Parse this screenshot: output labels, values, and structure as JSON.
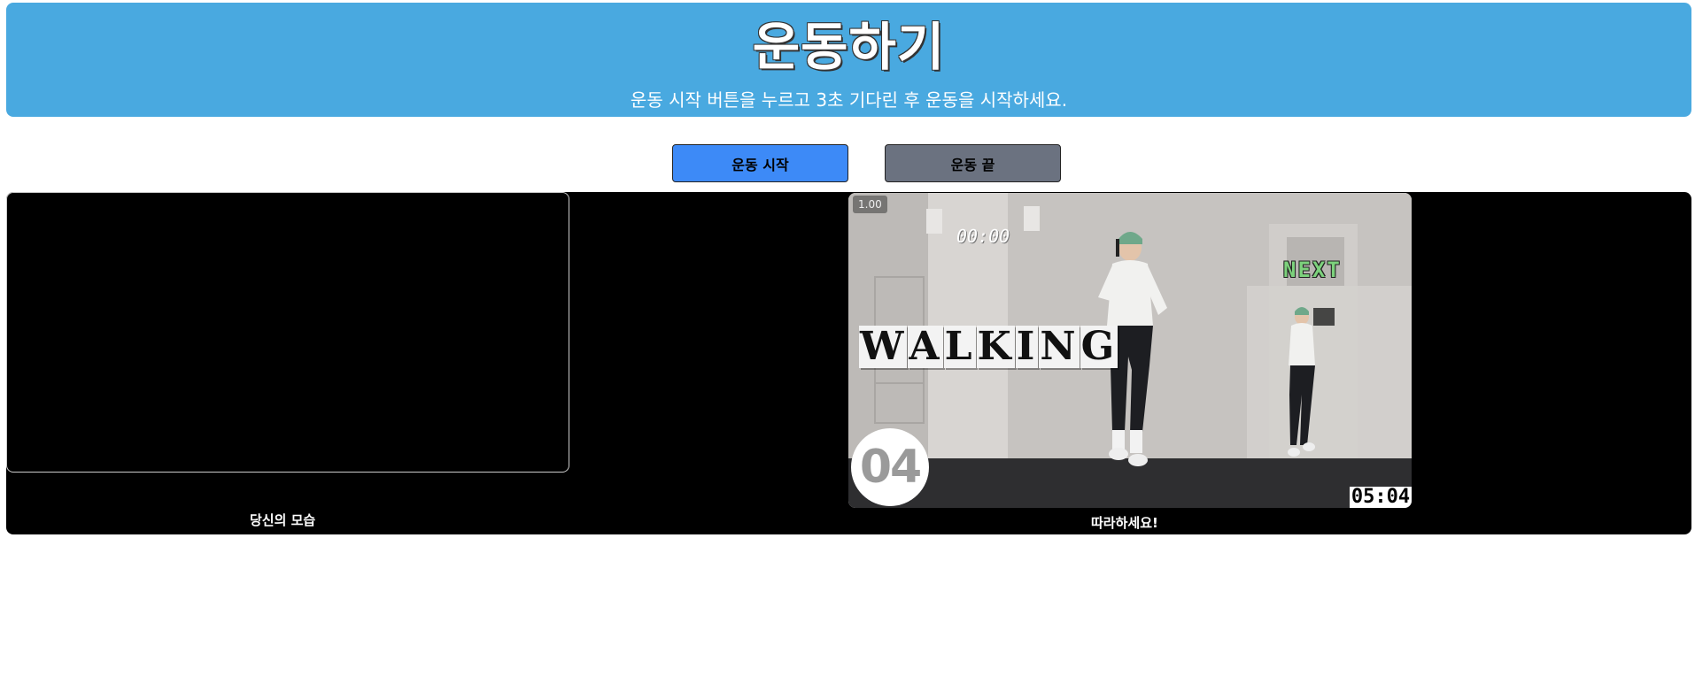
{
  "header": {
    "title": "운동하기",
    "subtitle": "운동 시작 버튼을 누르고 3초 기다린 후 운동을 시작하세요."
  },
  "controls": {
    "start_label": "운동 시작",
    "end_label": "운동 끝"
  },
  "camera": {
    "label": "당신의 모습"
  },
  "video": {
    "label": "따라하세요!",
    "playback_rate": "1.00",
    "timer": "05:04",
    "overlay_title": [
      "W",
      "A",
      "L",
      "K",
      "I",
      "N",
      "G"
    ],
    "next_sign": "NEXT",
    "clock_digits": "00:00",
    "round_number": "04"
  },
  "colors": {
    "header_bg": "#49a9e0",
    "start_button": "#3d8af7",
    "end_button": "#6b7280",
    "stage_bg": "#000000"
  }
}
